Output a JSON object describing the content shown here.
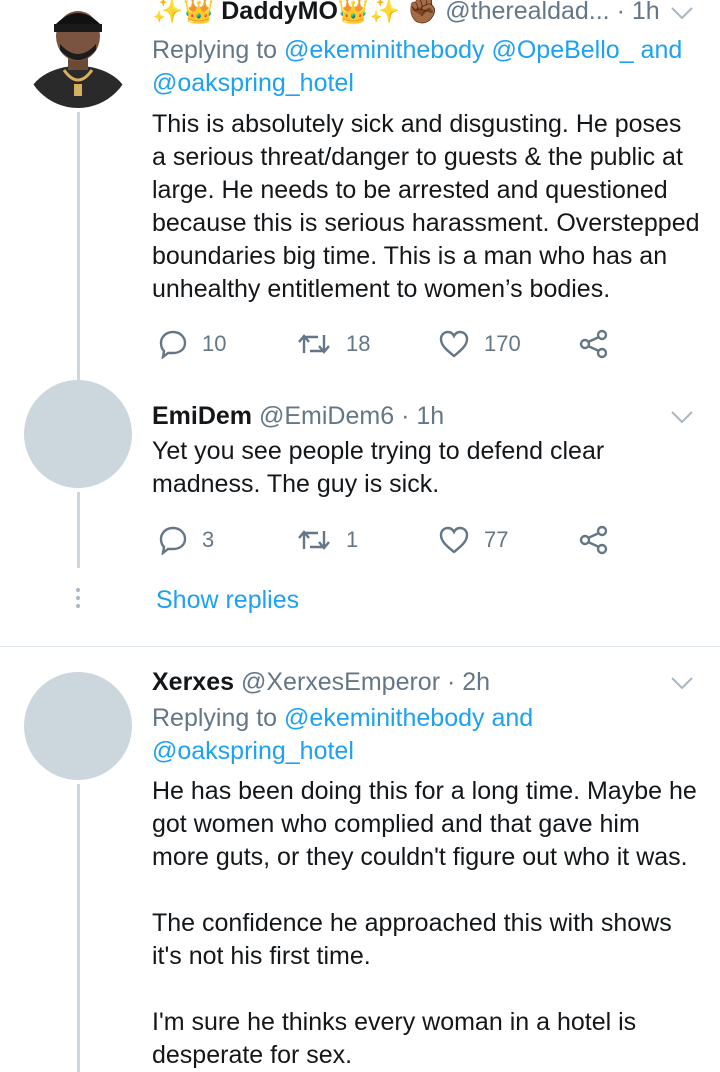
{
  "tweets": [
    {
      "name": "✨👑 DaddyMO👑✨✊🏾",
      "name_text": "DaddyMO",
      "handle": "@therealdad...",
      "time": "· 1h",
      "replying_prefix": "Replying to",
      "replying_mentions": "@ekeminithebody @OpeBello_",
      "replying_and": "and",
      "replying_mentions_2": "@oakspring_hotel",
      "text": "This is absolutely sick and disgusting. He poses\na serious threat/danger to guests & the public at\nlarge. He needs to be arrested and questioned\nbecause this is serious harassment. Overstepped\nboundaries big time. This is a man who has an\nunhealthy entitlement to women’s bodies.",
      "replies": "10",
      "retweets": "18",
      "likes": "170"
    },
    {
      "name": "EmiDem",
      "handle": "@EmiDem6",
      "time": "· 1h",
      "text": "Yet you see people trying to defend clear\nmadness. The guy is sick.",
      "replies": "3",
      "retweets": "1",
      "likes": "77"
    },
    {
      "name": "Xerxes",
      "handle": "@XerxesEmperor",
      "time": "· 2h",
      "replying_prefix": "Replying to",
      "replying_mentions": "@ekeminithebody",
      "replying_and": "and",
      "replying_mentions_2": "@oakspring_hotel",
      "text": "He has been doing this for a long time. Maybe he\ngot women who complied and that gave him\nmore guts, or they couldn't figure out who it was.\n\nThe confidence he approached this with shows\nit's not his first time.\n\nI'm sure he thinks every woman in a hotel is\ndesperate for sex."
    }
  ],
  "show_replies": "Show replies",
  "colors": {
    "accent": "#1da1f2",
    "muted": "#657786",
    "avatar_placeholder": "#ccd6dd"
  }
}
